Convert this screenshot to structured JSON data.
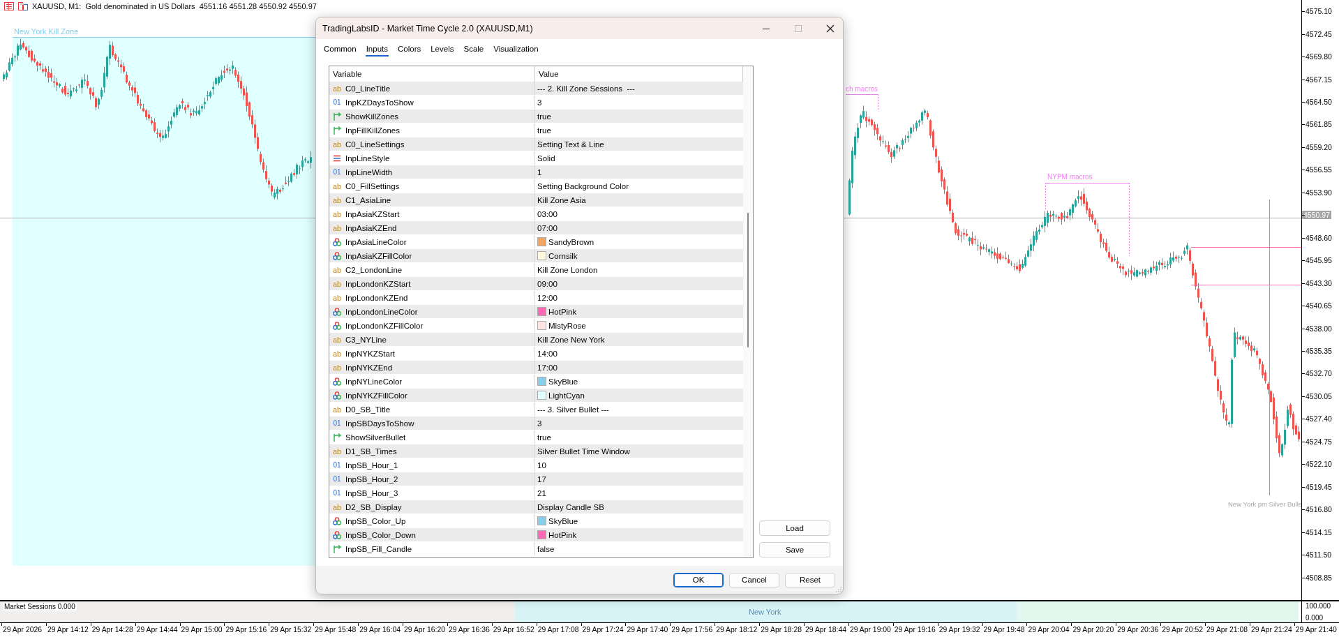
{
  "chart": {
    "header": "XAUUSD, M1:  Gold denominated in US Dollars  4551.16 4551.28 4550.92 4550.97",
    "kill_zone": {
      "label": "New York Kill Zone"
    },
    "macros": [
      {
        "label": "ch macros"
      },
      {
        "label": "NYPM macros"
      }
    ],
    "silver_bullet": {
      "label": "New York pm Silver Bulle"
    }
  },
  "price_axis": [
    {
      "label": "4575.10"
    },
    {
      "label": "4572.45"
    },
    {
      "label": "4569.80"
    },
    {
      "label": "4567.15"
    },
    {
      "label": "4564.50"
    },
    {
      "label": "4561.85"
    },
    {
      "label": "4559.20"
    },
    {
      "label": "4556.55"
    },
    {
      "label": "4553.90"
    },
    {
      "label": "4550.97",
      "kind": "current"
    },
    {
      "label": "4548.60"
    },
    {
      "label": "4545.95"
    },
    {
      "label": "4543.30"
    },
    {
      "label": "4540.65"
    },
    {
      "label": "4538.00"
    },
    {
      "label": "4535.35"
    },
    {
      "label": "4532.70"
    },
    {
      "label": "4530.05"
    },
    {
      "label": "4527.40"
    },
    {
      "label": "4524.75"
    },
    {
      "label": "4522.10"
    },
    {
      "label": "4519.45"
    },
    {
      "label": "4516.80"
    },
    {
      "label": "4514.15"
    },
    {
      "label": "4511.50"
    },
    {
      "label": "4508.85"
    }
  ],
  "sessions_panel": {
    "title": "Market Sessions 0.000",
    "session_label": "New York",
    "scale": [
      "100.000",
      "0.000"
    ]
  },
  "time_axis": [
    "29 Apr 2026",
    "29 Apr 14:12",
    "29 Apr 14:28",
    "29 Apr 14:44",
    "29 Apr 15:00",
    "29 Apr 15:16",
    "29 Apr 15:32",
    "29 Apr 15:48",
    "29 Apr 16:04",
    "29 Apr 16:20",
    "29 Apr 16:36",
    "29 Apr 16:52",
    "29 Apr 17:08",
    "29 Apr 17:24",
    "29 Apr 17:40",
    "29 Apr 17:56",
    "29 Apr 18:12",
    "29 Apr 18:28",
    "29 Apr 18:44",
    "29 Apr 19:00",
    "29 Apr 19:16",
    "29 Apr 19:32",
    "29 Apr 19:48",
    "29 Apr 20:04",
    "29 Apr 20:20",
    "29 Apr 20:36",
    "29 Apr 20:52",
    "29 Apr 21:08",
    "29 Apr 21:24",
    "29 Apr 21:40"
  ],
  "dialog": {
    "title": "TradingLabsID - Market Time Cycle 2.0 (XAUUSD,M1)",
    "tabs": [
      {
        "label": "Common",
        "selected": false
      },
      {
        "label": "Inputs",
        "selected": true
      },
      {
        "label": "Colors",
        "selected": false
      },
      {
        "label": "Levels",
        "selected": false
      },
      {
        "label": "Scale",
        "selected": false
      },
      {
        "label": "Visualization",
        "selected": false
      }
    ],
    "table": {
      "columns": [
        "Variable",
        "Value"
      ],
      "rows": [
        {
          "kind": "string",
          "badge": "ab",
          "name": "C0_LineTitle",
          "value": "--- 2. Kill Zone Sessions  ---"
        },
        {
          "kind": "int",
          "badge": "01",
          "name": "InpKZDaysToShow",
          "value": "3"
        },
        {
          "kind": "bool",
          "name": "ShowKillZones",
          "value": "true"
        },
        {
          "kind": "bool",
          "name": "InpFillKillZones",
          "value": "true"
        },
        {
          "kind": "string",
          "badge": "ab",
          "name": "C0_LineSettings",
          "value": "Setting Text & Line"
        },
        {
          "kind": "enum",
          "name": "InpLineStyle",
          "value": "Solid"
        },
        {
          "kind": "int",
          "badge": "01",
          "name": "InpLineWidth",
          "value": "1"
        },
        {
          "kind": "string",
          "badge": "ab",
          "name": "C0_FillSettings",
          "value": "Setting Background Color"
        },
        {
          "kind": "string",
          "badge": "ab",
          "name": "C1_AsiaLine",
          "value": "Kill Zone Asia"
        },
        {
          "kind": "string",
          "badge": "ab",
          "name": "InpAsiaKZStart",
          "value": "03:00"
        },
        {
          "kind": "string",
          "badge": "ab",
          "name": "InpAsiaKZEnd",
          "value": "07:00"
        },
        {
          "kind": "color",
          "name": "InpAsiaLineColor",
          "value": "SandyBrown",
          "color": "#f4a460"
        },
        {
          "kind": "color",
          "name": "InpAsiaKZFillColor",
          "value": "Cornsilk",
          "color": "#fff8dc"
        },
        {
          "kind": "string",
          "badge": "ab",
          "name": "C2_LondonLine",
          "value": "Kill Zone London"
        },
        {
          "kind": "string",
          "badge": "ab",
          "name": "InpLondonKZStart",
          "value": "09:00"
        },
        {
          "kind": "string",
          "badge": "ab",
          "name": "InpLondonKZEnd",
          "value": "12:00"
        },
        {
          "kind": "color",
          "name": "InpLondonLineColor",
          "value": "HotPink",
          "color": "#ff69b4"
        },
        {
          "kind": "color",
          "name": "InpLondonKZFillColor",
          "value": "MistyRose",
          "color": "#ffe4e1"
        },
        {
          "kind": "string",
          "badge": "ab",
          "name": "C3_NYLine",
          "value": "Kill Zone New York"
        },
        {
          "kind": "string",
          "badge": "ab",
          "name": "InpNYKZStart",
          "value": "14:00"
        },
        {
          "kind": "string",
          "badge": "ab",
          "name": "InpNYKZEnd",
          "value": "17:00"
        },
        {
          "kind": "color",
          "name": "InpNYLineColor",
          "value": "SkyBlue",
          "color": "#87ceeb"
        },
        {
          "kind": "color",
          "name": "InpNYKZFillColor",
          "value": "LightCyan",
          "color": "#e0ffff"
        },
        {
          "kind": "string",
          "badge": "ab",
          "name": "D0_SB_Title",
          "value": "--- 3. Silver Bullet ---"
        },
        {
          "kind": "int",
          "badge": "01",
          "name": "InpSBDaysToShow",
          "value": "3"
        },
        {
          "kind": "bool",
          "name": "ShowSilverBullet",
          "value": "true"
        },
        {
          "kind": "string",
          "badge": "ab",
          "name": "D1_SB_Times",
          "value": "Silver Bullet Time Window"
        },
        {
          "kind": "int",
          "badge": "01",
          "name": "InpSB_Hour_1",
          "value": "10"
        },
        {
          "kind": "int",
          "badge": "01",
          "name": "InpSB_Hour_2",
          "value": "17"
        },
        {
          "kind": "int",
          "badge": "01",
          "name": "InpSB_Hour_3",
          "value": "21"
        },
        {
          "kind": "string",
          "badge": "ab",
          "name": "D2_SB_Display",
          "value": "Display Candle SB"
        },
        {
          "kind": "color",
          "name": "InpSB_Color_Up",
          "value": "SkyBlue",
          "color": "#87ceeb"
        },
        {
          "kind": "color",
          "name": "InpSB_Color_Down",
          "value": "HotPink",
          "color": "#ff69b4"
        },
        {
          "kind": "bool",
          "name": "InpSB_Fill_Candle",
          "value": "false"
        }
      ]
    },
    "side_buttons": [
      "Load",
      "Save"
    ],
    "buttons": [
      {
        "label": "OK",
        "default": true
      },
      {
        "label": "Cancel",
        "default": false
      },
      {
        "label": "Reset",
        "default": false
      }
    ]
  }
}
